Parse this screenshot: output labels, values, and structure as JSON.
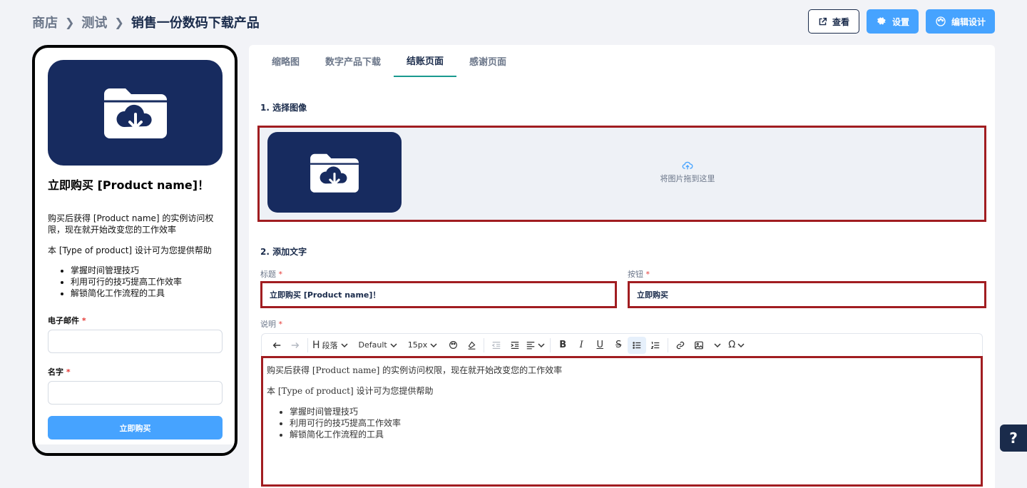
{
  "breadcrumb": {
    "items": [
      "商店",
      "测试",
      "销售一份数码下载产品"
    ]
  },
  "header": {
    "view_label": "查看",
    "settings_label": "设置",
    "edit_design_label": "编辑设计"
  },
  "preview": {
    "title": "立即购买 [Product name]！",
    "desc_p1": "购买后获得 [Product name] 的实例访问权限，现在就开始改变您的工作效率",
    "desc_p2": "本 [Type of product] 设计可为您提供帮助",
    "bullets": [
      "掌握时间管理技巧",
      "利用可行的技巧提高工作效率",
      "解锁简化工作流程的工具"
    ],
    "email_label": "电子邮件",
    "name_label": "名字",
    "required_mark": "*",
    "buy_button": "立即购买"
  },
  "tabs": [
    "缩略图",
    "数字产品下载",
    "结账页面",
    "感谢页面"
  ],
  "active_tab": "结账页面",
  "section1": {
    "title": "1. 选择图像",
    "drop_hint": "将图片拖到这里"
  },
  "section2": {
    "title": "2. 添加文字",
    "heading_label": "标题",
    "heading_value": "立即购买 [Product name]！",
    "button_label": "按钮",
    "button_value": "立即购买",
    "description_label": "说明",
    "required_mark": "*"
  },
  "toolbar": {
    "paragraph": "段落",
    "font": "Default",
    "size": "15px"
  },
  "editor": {
    "p1": "购买后获得 [Product name] 的实例访问权限，现在就开始改变您的工作效率",
    "p2": "本 [Type of product] 设计可为您提供帮助",
    "bullets": [
      "掌握时间管理技巧",
      "利用可行的技巧提高工作效率",
      "解锁简化工作流程的工具"
    ]
  },
  "help": {
    "label": "?"
  },
  "colors": {
    "navy": "#172b5f",
    "accent_blue": "#46a3ff",
    "highlight_red": "#a11d21",
    "tab_underline": "#1a9a8f"
  }
}
